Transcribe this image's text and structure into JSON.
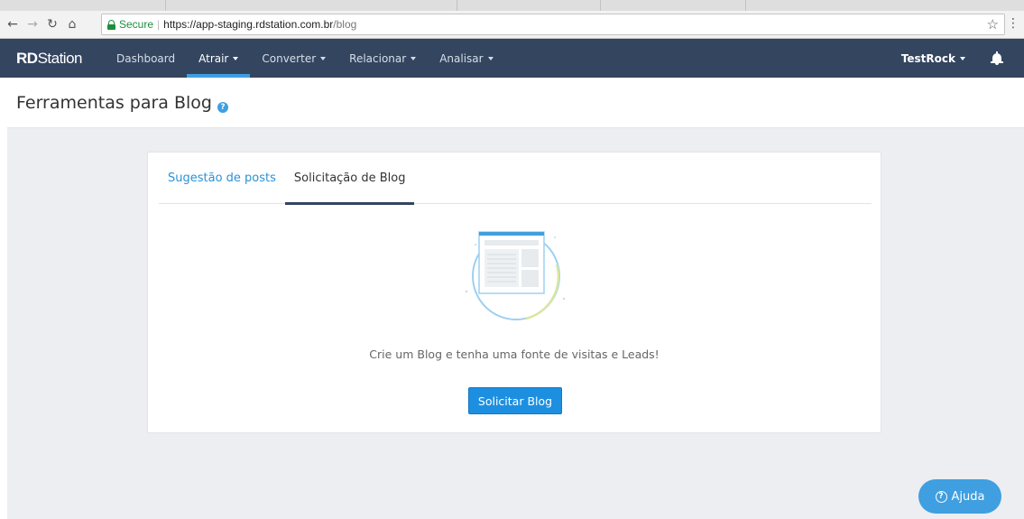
{
  "browser": {
    "secure_label": "Secure",
    "url_host": "https://app-staging.rdstation.com.br",
    "url_path": "/blog",
    "separator": "|"
  },
  "nav": {
    "brand_bold": "RD",
    "brand_rest": "Station",
    "items": [
      {
        "label": "Dashboard"
      },
      {
        "label": "Atrair"
      },
      {
        "label": "Converter"
      },
      {
        "label": "Relacionar"
      },
      {
        "label": "Analisar"
      }
    ],
    "user": "TestRock"
  },
  "page": {
    "title": "Ferramentas para Blog",
    "help_glyph": "?"
  },
  "card": {
    "tabs": [
      {
        "label": "Sugestão de posts"
      },
      {
        "label": "Solicitação de Blog"
      }
    ],
    "empty_message": "Crie um Blog e tenha uma fonte de visitas e Leads!",
    "button_label": "Solicitar Blog"
  },
  "help_fab": {
    "label": "Ajuda",
    "glyph": "?"
  },
  "colors": {
    "nav_bg": "#344560",
    "accent": "#3f9fe0",
    "button": "#1d8fe1",
    "link": "#2a92d8",
    "secure": "#1e8e3e"
  }
}
